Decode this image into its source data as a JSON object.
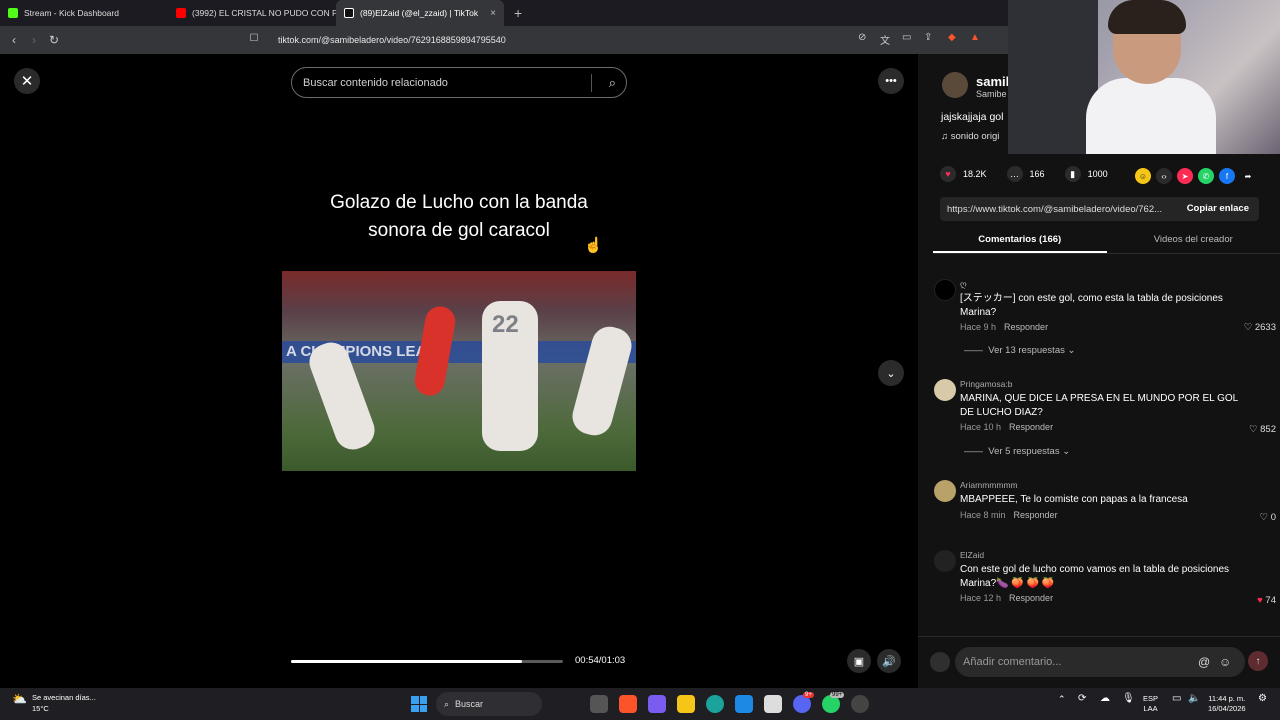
{
  "browser": {
    "tabs": [
      {
        "title": "Stream - Kick Dashboard",
        "color": "#53fc18"
      },
      {
        "title": "(3992) EL CRISTAL NO PUDO CON PA",
        "color": "#ff0000"
      },
      {
        "title": "(89)ElZaid (@el_zzaid) | TikTok",
        "color": "#ffffff"
      }
    ],
    "new_tab": "+",
    "close_glyph": "×",
    "url": "tiktok.com/@samibeladero/video/7629168859894795540"
  },
  "video": {
    "search_placeholder": "Buscar contenido relacionado",
    "title_line1": "Golazo de Lucho con la banda",
    "title_line2": "sonora de gol caracol",
    "banner_text": "A CHAMPIONS LEAGU",
    "jersey_number": "22",
    "time": "00:54/01:03",
    "progress": 0.85
  },
  "author": {
    "name": "samib",
    "subname": "Samibe",
    "caption": "jajskajjaja gol",
    "sound": "sonido origi"
  },
  "stats": {
    "likes": "18.2K",
    "comments": "166",
    "saves": "1000"
  },
  "link": {
    "url": "https://www.tiktok.com/@samibeladero/video/762...",
    "copy_label": "Copiar enlace"
  },
  "comment_tabs": {
    "comments": "Comentarios (166)",
    "creator_videos": "Videos del creador"
  },
  "comments": [
    {
      "user": "ღ",
      "text": "[ステッカー] con este gol, como esta la tabla de posiciones Marina?",
      "time": "Hace 9 h",
      "reply": "Responder",
      "likes": "2633",
      "replies": "Ver 13 respuestas"
    },
    {
      "user": "Pringamosa:b",
      "text": "MARINA, QUE DICE LA PRESA EN EL MUNDO POR EL GOL DE LUCHO DIAZ?",
      "time": "Hace 10 h",
      "reply": "Responder",
      "likes": "852",
      "replies": "Ver 5 respuestas"
    },
    {
      "user": "Ariammmmmm",
      "text": "MBAPPEEE, Te lo comiste con papas a la francesa",
      "time": "Hace 8 min",
      "reply": "Responder",
      "likes": "0"
    },
    {
      "user": "ElZaid",
      "text": "Con este gol de lucho como vamos en la tabla de posiciones Marina?🍆 🍑 🍑 🍑",
      "time": "Hace 12 h",
      "reply": "Responder",
      "likes": "74"
    }
  ],
  "add_comment_placeholder": "Añadir comentario...",
  "taskbar": {
    "weather_line1": "Se avecinan días...",
    "weather_line2": "15°C",
    "search_label": "Buscar",
    "lang_line1": "ESP",
    "lang_line2": "LAA",
    "time": "11:44 p. m.",
    "date": "16/04/2026",
    "badge_discord": "9+",
    "badge_whatsapp": "99+"
  },
  "colors": {
    "like": "#fe2c55",
    "accent_blue": "#3aa0f0"
  }
}
